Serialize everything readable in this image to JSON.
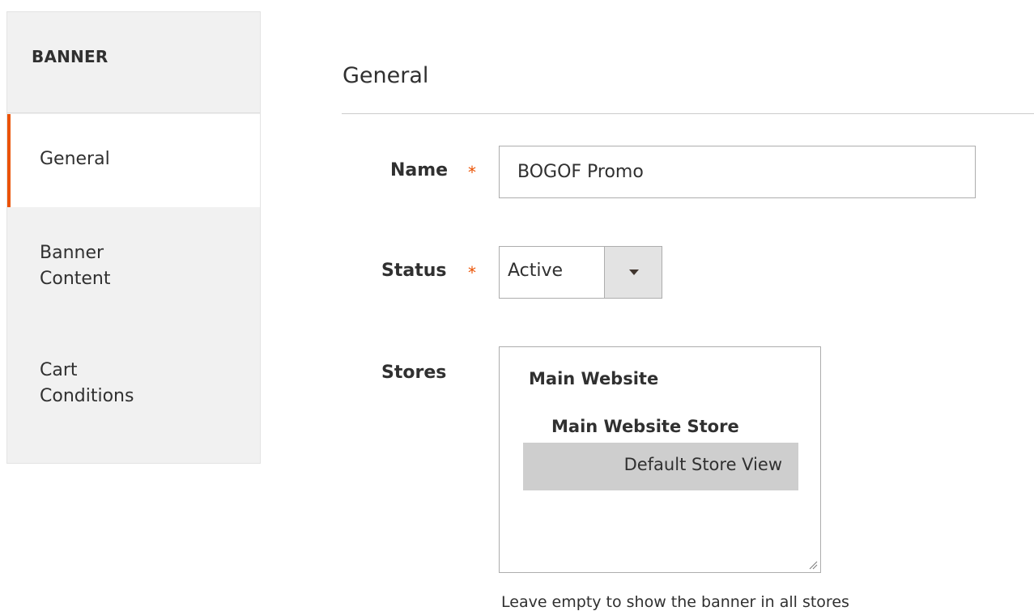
{
  "sidebar": {
    "title": "BANNER",
    "items": [
      {
        "label_lines": [
          "General"
        ],
        "active": true
      },
      {
        "label_lines": [
          "Banner",
          "Content"
        ],
        "active": false
      },
      {
        "label_lines": [
          "Cart",
          "Conditions"
        ],
        "active": false
      }
    ]
  },
  "main": {
    "section_title": "General",
    "fields": {
      "name": {
        "label": "Name",
        "required_mark": "*",
        "value": "BOGOF Promo"
      },
      "status": {
        "label": "Status",
        "required_mark": "*",
        "selected": "Active"
      },
      "stores": {
        "label": "Stores",
        "groups": [
          "Main Website",
          "Main Website Store"
        ],
        "options": [
          "Default Store View"
        ],
        "note": "Leave empty to show the banner in all stores"
      }
    }
  },
  "colors": {
    "accent": "#eb5202",
    "sidebar_bg": "#f1f1f1",
    "selected_option_bg": "#cecece",
    "text": "#303030"
  },
  "icons": [
    "chevron-down-icon",
    "resize-grip-icon"
  ]
}
